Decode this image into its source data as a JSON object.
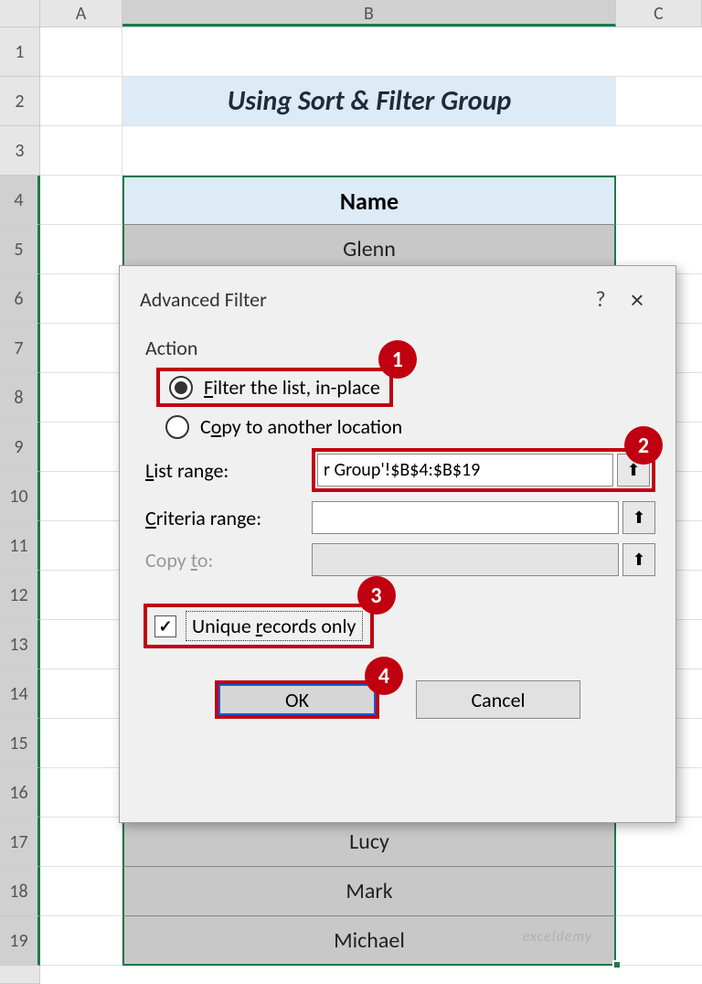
{
  "columns": [
    "A",
    "B",
    "C"
  ],
  "rows": [
    "1",
    "2",
    "3",
    "4",
    "5",
    "6",
    "7",
    "8",
    "9",
    "10",
    "11",
    "12",
    "13",
    "14",
    "15",
    "16",
    "17",
    "18",
    "19"
  ],
  "title": "Using Sort & Filter Group",
  "table": {
    "header": "Name",
    "visible_rows": {
      "5": "Glenn",
      "17": "Lucy",
      "18": "Mark",
      "19": "Michael"
    }
  },
  "dialog": {
    "title": "Advanced Filter",
    "help": "?",
    "close": "×",
    "section_action": "Action",
    "radio1": "Filter the list, in-place",
    "radio2": "Copy to another location",
    "label_list_range": "List range:",
    "input_list_range": "r Group'!$B$4:$B$19",
    "label_criteria_range": "Criteria range:",
    "input_criteria_range": "",
    "label_copy_to": "Copy to:",
    "input_copy_to": "",
    "checkbox_label": "Unique records only",
    "btn_ok": "OK",
    "btn_cancel": "Cancel"
  },
  "badges": {
    "b1": "1",
    "b2": "2",
    "b3": "3",
    "b4": "4"
  },
  "watermark": "exceldemy",
  "icons": {
    "collapse": "⬆"
  }
}
